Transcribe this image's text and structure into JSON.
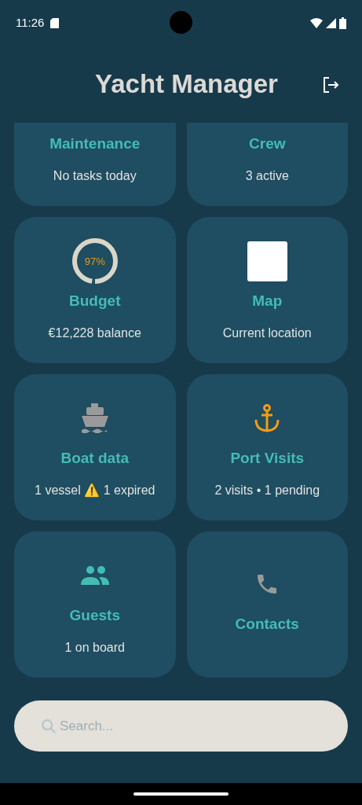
{
  "status_bar": {
    "time": "11:26"
  },
  "header": {
    "title": "Yacht Manager"
  },
  "tiles": [
    {
      "kind": "text",
      "title": "Maintenance",
      "subtitle": "No tasks today"
    },
    {
      "kind": "text",
      "title": "Crew",
      "subtitle": "3 active"
    },
    {
      "kind": "donut",
      "title": "Budget",
      "subtitle": "€12,228 balance",
      "level": 0.97,
      "reading": "97%"
    },
    {
      "kind": "square",
      "title": "Map",
      "subtitle": "Current location"
    },
    {
      "kind": "ship",
      "title": "Boat data",
      "subtitle": "1 vessel ⚠️ 1 expired"
    },
    {
      "kind": "anchor",
      "title": "Port Visits",
      "subtitle": "2 visits • 1 pending"
    },
    {
      "kind": "people",
      "title": "Guests",
      "subtitle": "1 on board"
    },
    {
      "kind": "phone",
      "title": "Contacts"
    }
  ],
  "search": {
    "placeholder": "Search..."
  }
}
